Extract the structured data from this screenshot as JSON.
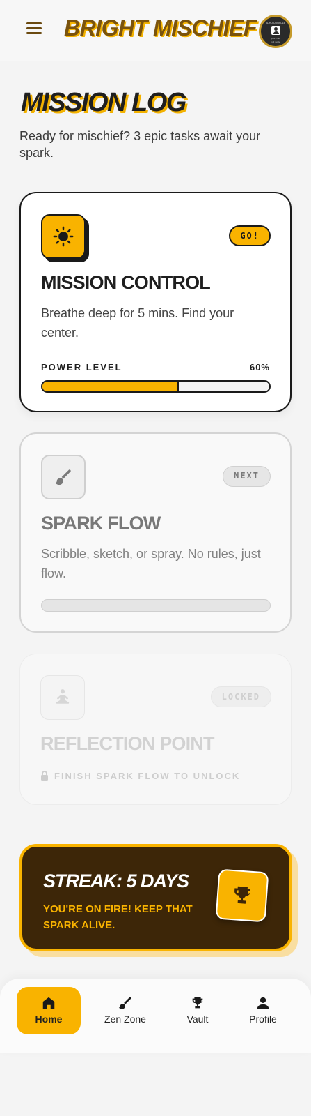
{
  "app": {
    "brand": "BRIGHT MISCHIEF",
    "avatar": {
      "top_text": "ADHD CONSOLE",
      "bottom_text_1": "your chat",
      "bottom_text_2": "bolt mode"
    }
  },
  "page": {
    "title": "MISSION LOG",
    "subtitle": "Ready for mischief? 3 epic tasks await your spark."
  },
  "tasks": [
    {
      "icon": "sun-icon",
      "badge": "GO!",
      "title": "MISSION CONTROL",
      "description": "Breathe deep for 5 mins. Find your center.",
      "power_label": "POWER LEVEL",
      "power_value": "60%",
      "progress": 0.6,
      "state": "active"
    },
    {
      "icon": "brush-icon",
      "badge": "NEXT",
      "title": "SPARK FLOW",
      "description": "Scribble, sketch, or spray. No rules, just flow.",
      "progress": 0,
      "state": "next"
    },
    {
      "icon": "meditation-icon",
      "badge": "LOCKED",
      "title": "REFLECTION POINT",
      "lock_text": "FINISH SPARK FLOW TO UNLOCK",
      "state": "locked"
    }
  ],
  "streak": {
    "title": "STREAK: 5 DAYS",
    "subtitle": "YOU'RE ON FIRE! KEEP THAT SPARK ALIVE.",
    "icon": "trophy-icon"
  },
  "nav": {
    "items": [
      {
        "label": "Home",
        "icon": "home-icon",
        "active": true
      },
      {
        "label": "Zen Zone",
        "icon": "brush-icon",
        "active": false
      },
      {
        "label": "Vault",
        "icon": "trophy-icon",
        "active": false
      },
      {
        "label": "Profile",
        "icon": "person-icon",
        "active": false
      }
    ]
  },
  "colors": {
    "accent": "#f9b300",
    "brand_brown": "#7a530d",
    "streak_bg": "#3d2608",
    "ink": "#1a1a1a"
  }
}
